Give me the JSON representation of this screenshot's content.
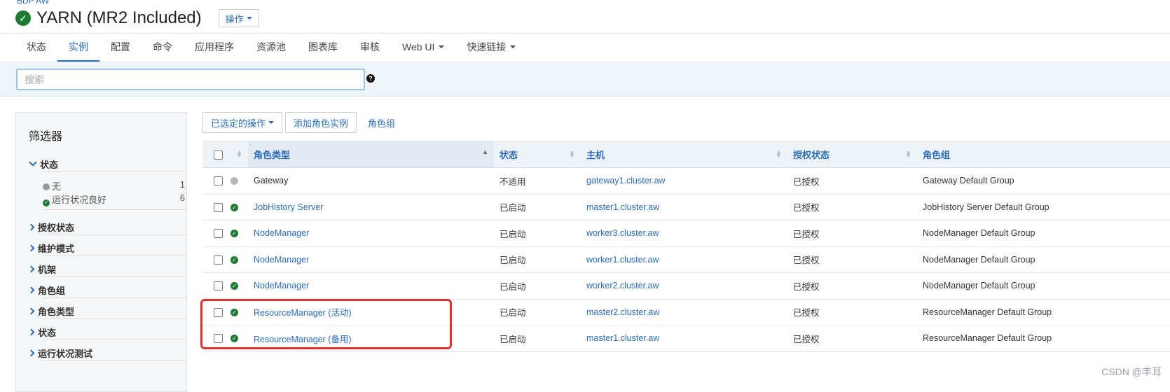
{
  "header": {
    "breadcrumb": "BDP AW",
    "title": "YARN (MR2 Included)",
    "actions_label": "操作"
  },
  "tabs": [
    {
      "label": "状态"
    },
    {
      "label": "实例",
      "active": true
    },
    {
      "label": "配置"
    },
    {
      "label": "命令"
    },
    {
      "label": "应用程序"
    },
    {
      "label": "资源池"
    },
    {
      "label": "图表库"
    },
    {
      "label": "审核"
    },
    {
      "label": "Web UI",
      "dropdown": true
    },
    {
      "label": "快速链接",
      "dropdown": true
    }
  ],
  "search": {
    "placeholder": "搜索",
    "value": ""
  },
  "filters": {
    "title": "筛选器",
    "status_section": "状态",
    "status_items": [
      {
        "label": "无",
        "count": "1"
      },
      {
        "label": "运行状况良好",
        "count": "6"
      }
    ],
    "sections": [
      "授权状态",
      "维护模式",
      "机架",
      "角色组",
      "角色类型",
      "状态",
      "运行状况测试"
    ]
  },
  "toolbar": {
    "selected_actions": "已选定的操作",
    "add_role_instance": "添加角色实例",
    "role_groups": "角色组"
  },
  "table": {
    "headers": [
      "角色类型",
      "状态",
      "主机",
      "授权状态",
      "角色组"
    ],
    "rows": [
      {
        "role": "Gateway",
        "status": "不适用",
        "host": "gateway1.cluster.aw",
        "auth": "已授权",
        "group": "Gateway Default Group",
        "health": "none"
      },
      {
        "role": "JobHistory Server",
        "status": "已启动",
        "host": "master1.cluster.aw",
        "auth": "已授权",
        "group": "JobHistory Server Default Group",
        "health": "good"
      },
      {
        "role": "NodeManager",
        "status": "已启动",
        "host": "worker3.cluster.aw",
        "auth": "已授权",
        "group": "NodeManager Default Group",
        "health": "good"
      },
      {
        "role": "NodeManager",
        "status": "已启动",
        "host": "worker1.cluster.aw",
        "auth": "已授权",
        "group": "NodeManager Default Group",
        "health": "good"
      },
      {
        "role": "NodeManager",
        "status": "已启动",
        "host": "worker2.cluster.aw",
        "auth": "已授权",
        "group": "NodeManager Default Group",
        "health": "good"
      },
      {
        "role": "ResourceManager (活动)",
        "status": "已启动",
        "host": "master2.cluster.aw",
        "auth": "已授权",
        "group": "ResourceManager Default Group",
        "health": "good"
      },
      {
        "role": "ResourceManager (备用)",
        "status": "已启动",
        "host": "master1.cluster.aw",
        "auth": "已授权",
        "group": "ResourceManager Default Group",
        "health": "good"
      }
    ]
  },
  "watermark": "CSDN @丰耳",
  "colors": {
    "accent": "#2a6ebb",
    "good": "#1f7a32",
    "highlight": "#e0302f"
  }
}
